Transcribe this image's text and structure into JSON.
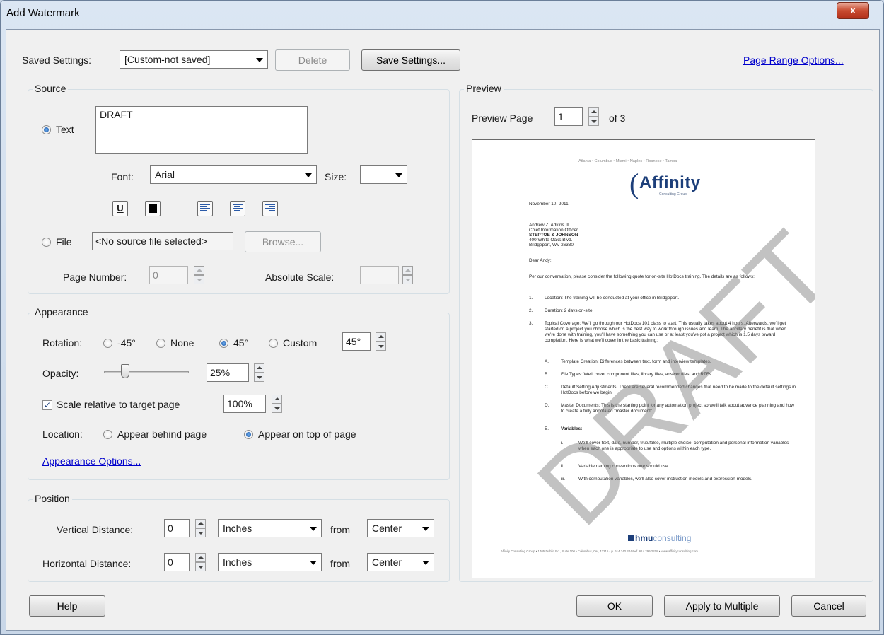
{
  "window": {
    "title": "Add Watermark",
    "close_glyph": "x"
  },
  "top": {
    "saved_settings_label": "Saved Settings:",
    "saved_settings_value": "[Custom-not saved]",
    "delete_label": "Delete",
    "save_settings_label": "Save Settings...",
    "page_range_link": "Page Range Options..."
  },
  "source": {
    "title": "Source",
    "text_label": "Text",
    "text_value": "DRAFT",
    "font_label": "Font:",
    "font_value": "Arial",
    "size_label": "Size:",
    "size_value": "",
    "underline_glyph": "U",
    "file_label": "File",
    "file_value": "<No source file selected>",
    "browse_label": "Browse...",
    "page_number_label": "Page Number:",
    "page_number_value": "0",
    "absolute_scale_label": "Absolute Scale:",
    "absolute_scale_value": ""
  },
  "appearance": {
    "title": "Appearance",
    "rotation_label": "Rotation:",
    "rot_options": [
      "-45°",
      "None",
      "45°",
      "Custom"
    ],
    "rot_selected": "45°",
    "custom_value": "45°",
    "opacity_label": "Opacity:",
    "opacity_value": "25%",
    "opacity_fraction": 0.25,
    "scale_label": "Scale relative to target page",
    "scale_checked": true,
    "scale_value": "100%",
    "location_label": "Location:",
    "loc_behind": "Appear behind page",
    "loc_top": "Appear on top of page",
    "options_link": "Appearance Options..."
  },
  "position": {
    "title": "Position",
    "vertical_label": "Vertical Distance:",
    "vertical_value": "0",
    "vertical_unit": "Inches",
    "vertical_from_label": "from",
    "vertical_from": "Center",
    "horizontal_label": "Horizontal Distance:",
    "horizontal_value": "0",
    "horizontal_unit": "Inches",
    "horizontal_from_label": "from",
    "horizontal_from": "Center"
  },
  "preview": {
    "title": "Preview",
    "preview_page_label": "Preview Page",
    "page_value": "1",
    "of_label": "of 3",
    "doc": {
      "cities": "Atlanta • Columbus • Miami • Naples • Roanoke • Tampa",
      "logo": "Affinity",
      "logo_sub": "Consulting Group",
      "date": "November 10, 2011",
      "addr1": "Andrew Z. Adkins III",
      "addr2": "Chief Information Officer",
      "addr3": "STEPTOE & JOHNSON",
      "addr4": "400 White Oaks Blvd.",
      "addr5": "Bridgeport, WV 26330",
      "greeting": "Dear Andy:",
      "intro": "Per our conversation, please consider the following quote for on-site HotDocs training. The details are as follows:",
      "item1": "Location: The training will be conducted at your office in Bridgeport.",
      "item2": "Duration: 2 days on-site.",
      "item3": "Topical Coverage: We'll go through our HotDocs 101 class to start. This usually takes about 4 hours. Afterwards, we'll get started on a project you choose which is the best way to work through issues and learn. The ancillary benefit is that when we're done with training, you'll have something you can use or at least you've got a project which is 1.5 days toward completion. Here is what we'll cover in the basic training:",
      "subA": "Template Creation: Differences between text, form and interview templates.",
      "subB": "File Types: We'll cover component files, library files, answer files, and RTFs.",
      "subC": "Default Setting Adjustments: There are several recommended changes that need to be made to the default settings in HotDocs before we begin.",
      "subD": "Master Documents: This is the starting point for any automation project so we'll talk about advance planning and how to create a fully annotated \"master document\".",
      "subE": "Variables:",
      "subEi": "We'll cover text, date, number, true/false, multiple choice, computation and personal information variables - when each one is appropriate to use and options within each type.",
      "subEii": "Variable naming conventions one should use.",
      "subEiii": "With computation variables, we'll also cover instruction models and expression models.",
      "hmu_bold": "hmu",
      "hmu_rest": "consulting",
      "footer": "Affinity Consulting Group • 1405 Dublin Rd., Suite 100 • Columbus, OH, 43215 • p. 614.340.3444 • f. 614.299.2208 • www.affinityconsulting.com",
      "watermark": "DRAFT"
    }
  },
  "bottom": {
    "help_label": "Help",
    "ok_label": "OK",
    "apply_multiple_label": "Apply to Multiple",
    "cancel_label": "Cancel"
  }
}
